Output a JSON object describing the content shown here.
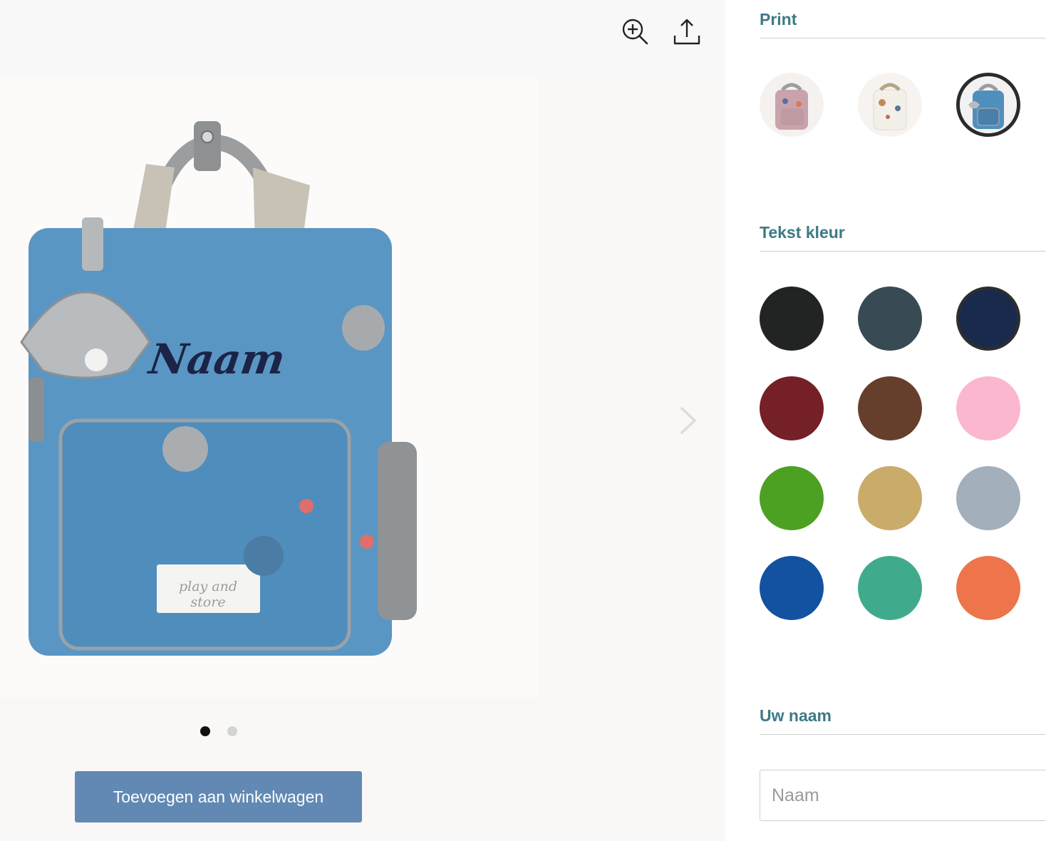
{
  "gallery": {
    "zoom_icon": "zoom-in-icon",
    "share_icon": "share-upload-icon",
    "next_icon": "chevron-right-icon",
    "product_name_overlay": "Naam",
    "brand_label": "play and store",
    "slide_count": 2,
    "active_slide": 1
  },
  "cart": {
    "add_label": "Toevoegen aan winkelwagen"
  },
  "options": {
    "print": {
      "title": "Print",
      "items": [
        {
          "name": "roze dierenprint",
          "selected": false
        },
        {
          "name": "wit bosprint",
          "selected": false
        },
        {
          "name": "blauw zeeprint",
          "selected": true
        }
      ]
    },
    "text_color": {
      "title": "Tekst kleur",
      "swatches": [
        {
          "color": "#222423",
          "selected": false
        },
        {
          "color": "#384a54",
          "selected": false
        },
        {
          "color": "#1a2a4d",
          "selected": true
        },
        {
          "color": "#751f27",
          "selected": false
        },
        {
          "color": "#663f2c",
          "selected": false
        },
        {
          "color": "#fbb7d0",
          "selected": false
        },
        {
          "color": "#4ca123",
          "selected": false
        },
        {
          "color": "#c9ab6a",
          "selected": false
        },
        {
          "color": "#a4afbc",
          "selected": false
        },
        {
          "color": "#1252a0",
          "selected": false
        },
        {
          "color": "#40ab8c",
          "selected": false
        },
        {
          "color": "#ed744b",
          "selected": false
        }
      ]
    },
    "name": {
      "title": "Uw naam",
      "placeholder": "Naam",
      "value": ""
    }
  }
}
